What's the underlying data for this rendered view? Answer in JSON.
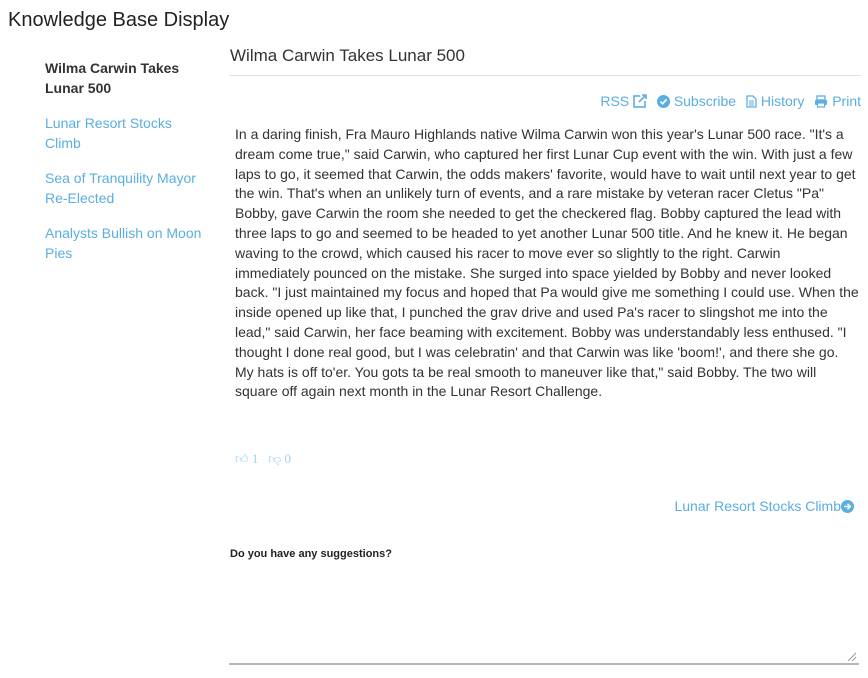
{
  "app": {
    "title": "Knowledge Base Display"
  },
  "sidebar": {
    "items": [
      {
        "label": "Wilma Carwin Takes Lunar 500"
      },
      {
        "label": "Lunar Resort Stocks Climb"
      },
      {
        "label": "Sea of Tranquility Mayor Re-Elected"
      },
      {
        "label": "Analysts Bullish on Moon Pies"
      }
    ]
  },
  "article": {
    "title": "Wilma Carwin Takes Lunar 500",
    "body": "In a daring finish, Fra Mauro Highlands native Wilma Carwin won this year's Lunar 500 race. \"It's a dream come true,\" said Carwin, who captured her first Lunar Cup event with the win. With just a few laps to go, it seemed that Carwin, the odds makers' favorite, would have to wait until next year to get the win. That's when an unlikely turn of events, and a rare mistake by veteran racer Cletus \"Pa\" Bobby, gave Carwin the room she needed to get the checkered flag. Bobby captured the lead with three laps to go and seemed to be headed to yet another Lunar 500 title. And he knew it. He began waving to the crowd, which caused his racer to move ever so slightly to the right. Carwin immediately pounced on the mistake. She surged into space yielded by Bobby and never looked back. \"I just maintained my focus and hoped that Pa would give me something I could use. When the inside opened up like that, I punched the grav drive and used Pa's racer to slingshot me into the lead,\" said Carwin, her face beaming with excitement. Bobby was understandably less enthused. \"I thought I done real good, but I was celebratin' and that Carwin was like 'boom!', and there she go. My hats is off to'er. You gots ta be real smooth to maneuver like that,\" said Bobby. The two will square off again next month in the Lunar Resort Challenge."
  },
  "toolbar": {
    "rss": "RSS",
    "subscribe": "Subscribe",
    "history": "History",
    "print": "Print"
  },
  "votes": {
    "up": "1",
    "down": "0"
  },
  "next": {
    "label": "Lunar Resort Stocks Climb"
  },
  "suggestions": {
    "label": "Do you have any suggestions?",
    "value": ""
  },
  "colors": {
    "accent": "#5aaee0",
    "vote": "#9fd2ef",
    "text": "#333333"
  },
  "icons": [
    "external-link-icon",
    "check-circle-icon",
    "document-icon",
    "printer-icon",
    "thumbs-up-icon",
    "thumbs-down-icon",
    "arrow-right-circle-icon"
  ]
}
